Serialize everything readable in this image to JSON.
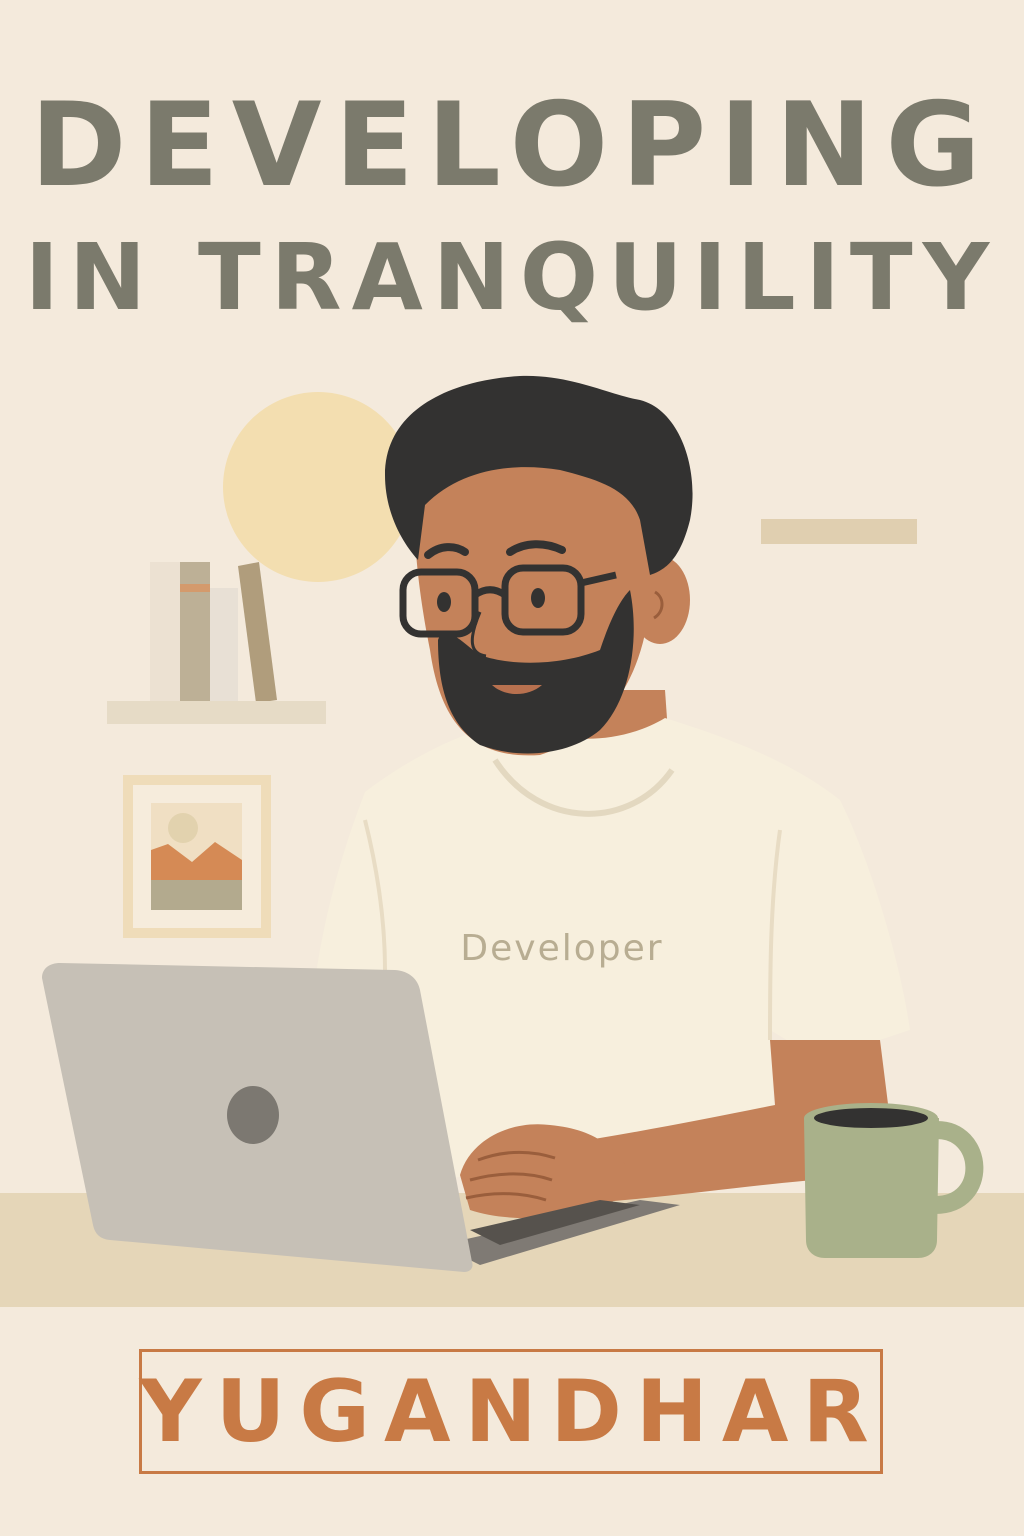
{
  "cover": {
    "title_line1": "DEVELOPING",
    "title_line2": "IN TRANQUILITY",
    "shirt_text": "Developer",
    "author": "YUGANDHAR"
  },
  "colors": {
    "background": "#f4eadc",
    "title": "#7b7a6c",
    "accent": "#c87a45",
    "skin": "#c4825a",
    "hair": "#333231",
    "shirt": "#f7efdd",
    "laptop": "#c6c0b6",
    "mug": "#a9b18a",
    "desk": "#e5d6b8",
    "sun": "#f3deb0"
  },
  "illustration": {
    "items": [
      "sun-circle",
      "bookshelf",
      "books",
      "picture-frame",
      "wall-shelf-line",
      "developer-person",
      "glasses",
      "laptop",
      "apple-logo-icon",
      "coffee-mug",
      "desk"
    ]
  }
}
